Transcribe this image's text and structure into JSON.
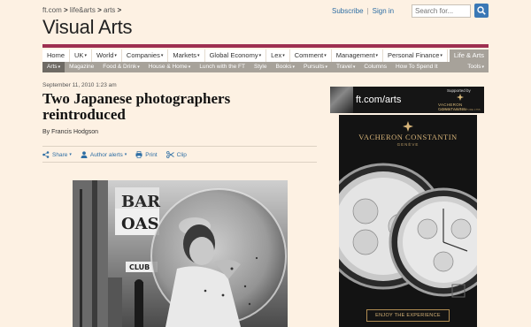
{
  "breadcrumb": {
    "site": "ft.com",
    "items": [
      "life&arts",
      "arts"
    ],
    "sep": ">"
  },
  "toplinks": {
    "subscribe": "Subscribe",
    "signin": "Sign in",
    "sep": "|"
  },
  "search": {
    "placeholder": "Search for..."
  },
  "section_title": "Visual Arts",
  "main_nav": [
    {
      "label": "Home",
      "caret": false
    },
    {
      "label": "UK",
      "caret": true
    },
    {
      "label": "World",
      "caret": true
    },
    {
      "label": "Companies",
      "caret": true
    },
    {
      "label": "Markets",
      "caret": true
    },
    {
      "label": "Global Economy",
      "caret": true
    },
    {
      "label": "Lex",
      "caret": true
    },
    {
      "label": "Comment",
      "caret": true
    },
    {
      "label": "Management",
      "caret": true
    },
    {
      "label": "Personal Finance",
      "caret": true
    },
    {
      "label": "Life & Arts",
      "caret": false,
      "active": true
    }
  ],
  "sub_nav": [
    {
      "label": "Arts",
      "caret": true,
      "active": true
    },
    {
      "label": "Magazine",
      "caret": false
    },
    {
      "label": "Food & Drink",
      "caret": true
    },
    {
      "label": "House & Home",
      "caret": true
    },
    {
      "label": "Lunch with the FT",
      "caret": false
    },
    {
      "label": "Style",
      "caret": false
    },
    {
      "label": "Books",
      "caret": true
    },
    {
      "label": "Pursuits",
      "caret": true
    },
    {
      "label": "Travel",
      "caret": true
    },
    {
      "label": "Columns",
      "caret": false
    },
    {
      "label": "How To Spend It",
      "caret": false
    },
    {
      "label": "Tools",
      "caret": true,
      "tools": true
    }
  ],
  "caret_glyph": "▾",
  "article": {
    "date": "September 11, 2010 1:23 am",
    "headline": "Two Japanese photographers reintroduced",
    "byline": "By Francis Hodgson"
  },
  "article_tools": {
    "share": "Share",
    "author_alerts": "Author alerts",
    "print": "Print",
    "clip": "Clip"
  },
  "photo": {
    "sign_top": "BAR",
    "sign_mid": "OAS",
    "sign_club": "CLUB"
  },
  "ad_banner": {
    "title": "ft.com/arts",
    "supported_by": "Supported by",
    "brand": "VACHERON CONSTANTIN",
    "brand_sub": "GENÈVE · MANUFACTURE 1755"
  },
  "ad_sky": {
    "brand": "VACHERON CONSTANTIN",
    "city": "GENÈVE",
    "cta": "ENJOY THE EXPERIENCE"
  },
  "colors": {
    "accent": "#9e2f50",
    "link": "#2e6ea4",
    "background": "#fdf1e3",
    "nav_gray": "#a7a29a"
  }
}
